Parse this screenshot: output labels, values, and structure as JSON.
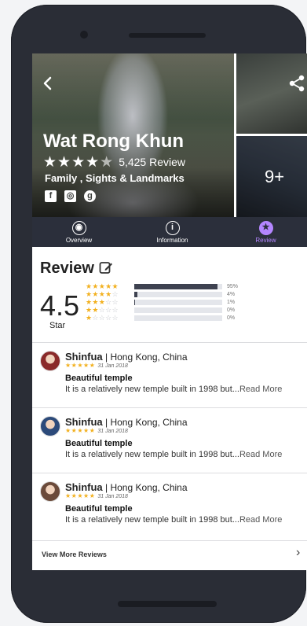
{
  "place": {
    "title": "Wat Rong Khun",
    "stars": "★★★★",
    "half_star": "★",
    "rating_value": 4.5,
    "review_count": "5,425 Review",
    "category": "Family , Sights & Landmarks",
    "more_photos": "9+"
  },
  "social": [
    {
      "icon": "facebook-icon",
      "glyph": "f"
    },
    {
      "icon": "instagram-icon",
      "glyph": "◎"
    },
    {
      "icon": "google-plus-icon",
      "glyph": "g"
    }
  ],
  "tabs": [
    {
      "label": "Overview",
      "icon": "eye-icon",
      "glyph": "◉",
      "active": false
    },
    {
      "label": "Information",
      "icon": "info-icon",
      "glyph": "i",
      "active": false
    },
    {
      "label": "Review",
      "icon": "star-icon",
      "glyph": "★",
      "active": true
    }
  ],
  "review_section": {
    "heading": "Review",
    "score": "4.5",
    "score_label": "Star",
    "distribution": [
      {
        "stars": 5,
        "percent": 95,
        "label": "95%"
      },
      {
        "stars": 4,
        "percent": 4,
        "label": "4%"
      },
      {
        "stars": 3,
        "percent": 1,
        "label": "1%"
      },
      {
        "stars": 2,
        "percent": 0,
        "label": "0%"
      },
      {
        "stars": 1,
        "percent": 0,
        "label": "0%"
      }
    ]
  },
  "reviews": [
    {
      "name": "Shinfua",
      "location": " | Hong Kong, China",
      "stars": "★★★★★",
      "date": "31 Jan 2018",
      "title": "Beautiful temple",
      "body": "It is a relatively new temple built in 1998 but...",
      "read_more": "Read More",
      "avatar_color": "#8a2a2a"
    },
    {
      "name": "Shinfua",
      "location": " | Hong Kong, China",
      "stars": "★★★★★",
      "date": "31 Jan 2018",
      "title": "Beautiful temple",
      "body": "It is a relatively new temple built in 1998 but...",
      "read_more": "Read More",
      "avatar_color": "#2c4a7a"
    },
    {
      "name": "Shinfua",
      "location": " | Hong Kong, China",
      "stars": "★★★★★",
      "date": "31 Jan 2018",
      "title": "Beautiful temple",
      "body": "It is a relatively new temple built in 1998 but...",
      "read_more": "Read More",
      "avatar_color": "#6b4a3a"
    }
  ],
  "footer": {
    "view_more": "View More Reviews",
    "chevron": "›"
  },
  "colors": {
    "accent": "#b486ff",
    "star": "#f2b01e",
    "tab_bar": "#2b2f3b"
  }
}
